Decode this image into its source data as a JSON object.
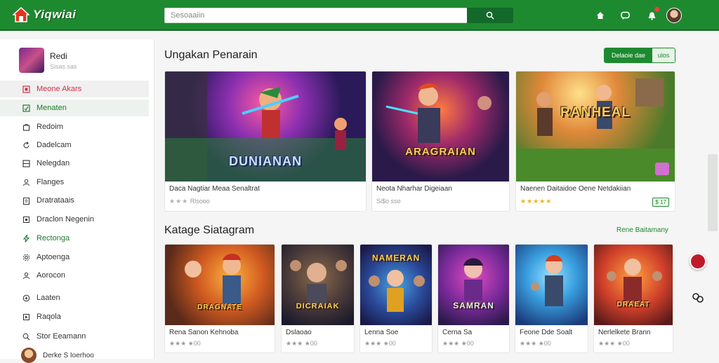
{
  "header": {
    "logo_text": "Yiqwiai",
    "search_placeholder": "Sesoaaiin"
  },
  "sidebar": {
    "profile": {
      "name": "Redi",
      "sub": "Sisas sas"
    },
    "items": [
      {
        "label": "Meone Akars"
      },
      {
        "label": "Menaten"
      },
      {
        "label": "Redoim"
      },
      {
        "label": "Dadelcam"
      },
      {
        "label": "Nelegdan"
      },
      {
        "label": "Flanges"
      },
      {
        "label": "Dratrataais"
      },
      {
        "label": "Draclon Negenin"
      },
      {
        "label": "Rectonga"
      },
      {
        "label": "Aptoenga"
      },
      {
        "label": "Aorocon"
      },
      {
        "label": "Laaten"
      },
      {
        "label": "Raqola"
      },
      {
        "label": "Stor Eeamann"
      }
    ],
    "footer_user": "Derke S Ioerhoo"
  },
  "section1": {
    "title": "Ungakan Penarain",
    "toggle_on": "Delaoie dae",
    "toggle_off": "ulos",
    "cards": [
      {
        "title": "Daca Nagtiar Meaa Senaltrat",
        "rating": "Rlsooo",
        "stars": "★★★",
        "thumb_text": "DUNIANAN"
      },
      {
        "title": "Neota Nharhar Digeiaan",
        "rating": "Si$o sso",
        "stars": "",
        "badge": "",
        "thumb_text": "ARAGRAIAN"
      },
      {
        "title": "Naenen Daitaidoe Oene Netdakiian",
        "rating": "",
        "stars": "★★★★★",
        "badge": "$ 17",
        "thumb_text": "RANHEAL"
      }
    ]
  },
  "section2": {
    "title": "Katage Siatagram",
    "see_all": "Rene Baitamany",
    "cards": [
      {
        "title": "Rena Sanon Kehnoba",
        "rating": "★★★ ★00",
        "thumb_text": "DRAGNATE"
      },
      {
        "title": "Dslaoao",
        "rating": "★★★ ★00",
        "thumb_text": "DICRAIAK"
      },
      {
        "title": "Lenna Soe",
        "rating": "★★★ ★00",
        "thumb_text": "NAMERAN"
      },
      {
        "title": "Cerna Sa",
        "rating": "★★★ ★00",
        "thumb_text": "SAMRAN"
      },
      {
        "title": "Feone Dde Soalt",
        "rating": "★★★ ★00",
        "thumb_text": ""
      },
      {
        "title": "Nerlelkete Brann",
        "rating": "★★★ ★00",
        "thumb_text": "DRAEAT"
      }
    ]
  },
  "colors": {
    "brand_green": "#1e8a30",
    "accent_red": "#d0304a"
  }
}
